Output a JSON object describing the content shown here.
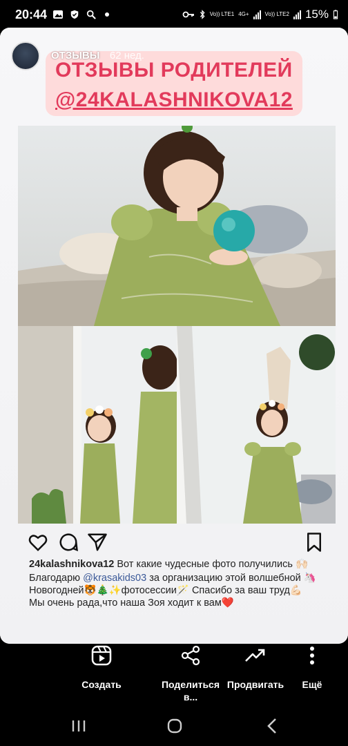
{
  "status_bar": {
    "time": "20:44",
    "net1": "Vo)) LTE1",
    "net_mid": "4G+",
    "net2": "Vo)) LTE2",
    "battery": "15%"
  },
  "story": {
    "username": "ОТЗЫВЫ",
    "time_ago": "62 нед.",
    "title_line1": "ОТЗЫВЫ РОДИТЕЛЕЙ",
    "title_line2": "@24KALASHNIKOVA12"
  },
  "post": {
    "author": "24kalashnikova12",
    "caption_text": " Вот какие чудесные фото получились 🙌🏻",
    "caption_line2_pre": "Благодарю ",
    "mention": "@krasakids03",
    "caption_line2_post": " за организацию этой волшебной 🦄 Новогодней🐯🎄✨фотосессии🪄 Спасибо за ваш труд💪🏻",
    "caption_line3": "Мы очень рада,что наша Зоя ходит к вам❤️"
  },
  "bottom_actions": {
    "create": "Создать",
    "share": "Поделиться в...",
    "promote": "Продвигать",
    "more": "Ещё"
  },
  "colors": {
    "title": "#e23a5b",
    "title_bg": "#ffd6d6",
    "dress": "#9cae5c"
  },
  "icons": [
    "heart-icon",
    "comment-icon",
    "send-icon",
    "bookmark-icon",
    "create-reel-icon",
    "share-icon",
    "promote-icon",
    "more-icon"
  ]
}
